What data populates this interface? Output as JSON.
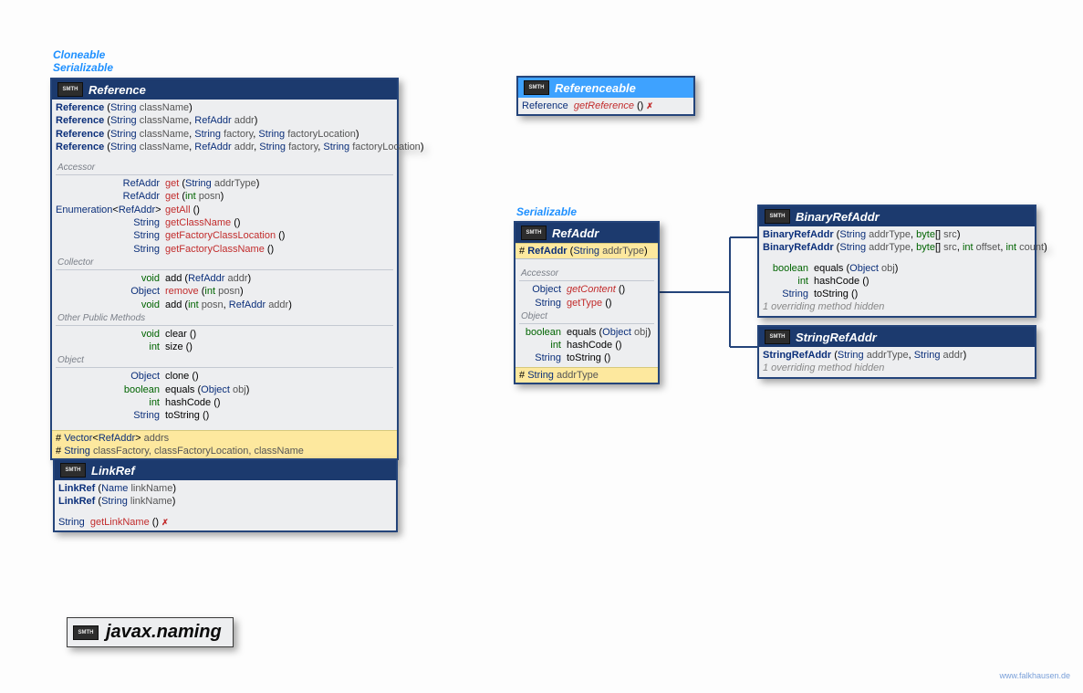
{
  "package": "javax.naming",
  "footer": "www.falkhausen.de",
  "labels": {
    "badge": "SMTH",
    "cloneable": "Cloneable",
    "serializable": "Serializable",
    "accessor": "Accessor",
    "collector": "Collector",
    "other": "Other Public Methods",
    "object": "Object",
    "hidden1": "1 overriding method hidden",
    "hidden_word_1": "1 overriding",
    "hidden_word_2": " method hidden"
  },
  "reference": {
    "name": "Reference",
    "ctors": [
      {
        "sig": "Reference (String className)"
      },
      {
        "sig": "Reference (String className, RefAddr addr)"
      },
      {
        "sig": "Reference (String className, String factory, String factoryLocation)"
      },
      {
        "sig": "Reference (String className, RefAddr addr, String factory, String factoryLocation)"
      }
    ],
    "accessor": [
      {
        "ret": "RefAddr",
        "name": "get",
        "params": "(String addrType)",
        "red": true
      },
      {
        "ret": "RefAddr",
        "name": "get",
        "params": "(int posn)",
        "red": true
      },
      {
        "ret": "Enumeration<RefAddr>",
        "name": "getAll",
        "params": "()",
        "red": true
      },
      {
        "ret": "String",
        "name": "getClassName",
        "params": "()",
        "red": true
      },
      {
        "ret": "String",
        "name": "getFactoryClassLocation",
        "params": "()",
        "red": true
      },
      {
        "ret": "String",
        "name": "getFactoryClassName",
        "params": "()",
        "red": true
      }
    ],
    "collector": [
      {
        "ret": "void",
        "name": "add",
        "params": "(RefAddr addr)"
      },
      {
        "ret": "Object",
        "name": "remove",
        "params": "(int posn)",
        "red": true
      },
      {
        "ret": "void",
        "name": "add",
        "params": "(int posn, RefAddr addr)"
      }
    ],
    "other": [
      {
        "ret": "void",
        "name": "clear",
        "params": "()"
      },
      {
        "ret": "int",
        "name": "size",
        "params": "()"
      }
    ],
    "objectM": [
      {
        "ret": "Object",
        "name": "clone",
        "params": "()"
      },
      {
        "ret": "boolean",
        "name": "equals",
        "params": "(Object obj)"
      },
      {
        "ret": "int",
        "name": "hashCode",
        "params": "()"
      },
      {
        "ret": "String",
        "name": "toString",
        "params": "()"
      }
    ],
    "protected": [
      "# Vector<RefAddr> addrs",
      "# String classFactory, classFactoryLocation, className"
    ]
  },
  "linkref": {
    "name": "LinkRef",
    "ctors": [
      {
        "sig": "LinkRef (Name linkName)"
      },
      {
        "sig": "LinkRef (String linkName)"
      }
    ],
    "methods": [
      {
        "ret": "String",
        "name": "getLinkName",
        "params": "()",
        "red": true,
        "throws": true
      }
    ]
  },
  "referenceable": {
    "name": "Referenceable",
    "methods": [
      {
        "ret": "Reference",
        "name": "getReference",
        "params": "()",
        "red": true,
        "throws": true
      }
    ]
  },
  "refaddr": {
    "name": "RefAddr",
    "protectedCtor": "# RefAddr (String addrType)",
    "accessor": [
      {
        "ret": "Object",
        "name": "getContent",
        "params": "()",
        "red": true,
        "italic": true
      },
      {
        "ret": "String",
        "name": "getType",
        "params": "()",
        "red": true
      }
    ],
    "objectM": [
      {
        "ret": "boolean",
        "name": "equals",
        "params": "(Object obj)"
      },
      {
        "ret": "int",
        "name": "hashCode",
        "params": "()"
      },
      {
        "ret": "String",
        "name": "toString",
        "params": "()"
      }
    ],
    "protectedField": "# String addrType"
  },
  "binaryrefaddr": {
    "name": "BinaryRefAddr",
    "ctors": [
      {
        "sig": "BinaryRefAddr (String addrType, byte[] src)"
      },
      {
        "sig": "BinaryRefAddr (String addrType, byte[] src, int offset, int count)"
      }
    ],
    "methods": [
      {
        "ret": "boolean",
        "name": "equals",
        "params": "(Object obj)"
      },
      {
        "ret": "int",
        "name": "hashCode",
        "params": "()"
      },
      {
        "ret": "String",
        "name": "toString",
        "params": "()"
      }
    ]
  },
  "stringrefaddr": {
    "name": "StringRefAddr",
    "ctors": [
      {
        "sig": "StringRefAddr (String addrType, String addr)"
      }
    ]
  }
}
